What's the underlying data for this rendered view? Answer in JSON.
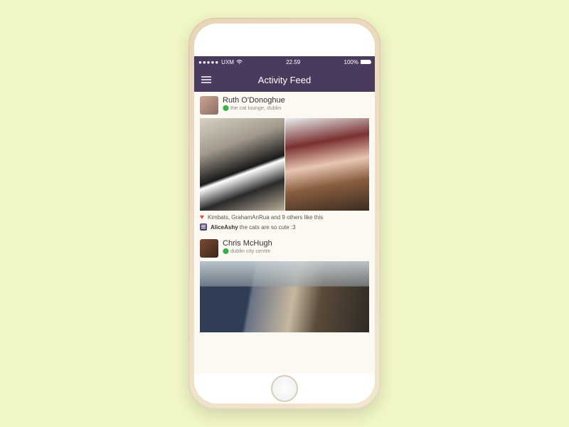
{
  "statusbar": {
    "carrier": "UXM",
    "time": "22.59",
    "battery": "100%"
  },
  "header": {
    "title": "Activity Feed"
  },
  "posts": [
    {
      "author": "Ruth O'Donoghue",
      "location": "the cat lounge, dublin",
      "likes_text": "Kimbats, GrahamAnRua and 9 others like this",
      "comment_author": "AliceAshy",
      "comment_text": " the cats are so cute :3"
    },
    {
      "author": "Chris McHugh",
      "location": "dublin city centre"
    }
  ]
}
